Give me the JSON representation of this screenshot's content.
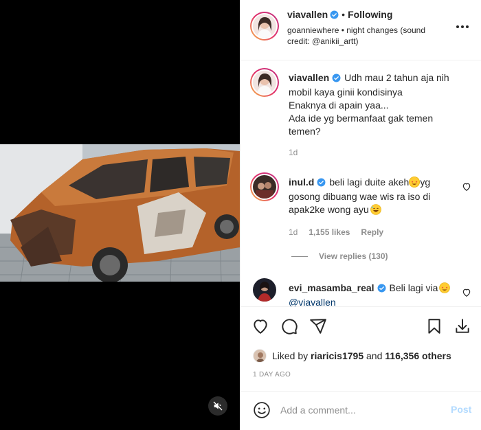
{
  "post": {
    "author": "viavallen",
    "following_label": "Following",
    "audio": "goanniewhere • night changes (sound credit: @anikii_artt)"
  },
  "caption": {
    "username": "viavallen",
    "lines": [
      "Udh mau 2 tahun aja nih",
      "mobil kaya ginii kondisinya",
      "Enaknya di apain yaa...",
      "Ada ide yg bermanfaat gak temen temen?"
    ],
    "age": "1d"
  },
  "comments": [
    {
      "username": "inul.d",
      "text_a": "beli lagi duite akeh",
      "text_b": "yg gosong dibuang wae wis ra iso di apak2ke wong ayu",
      "age": "1d",
      "likes": "1,155 likes",
      "reply_label": "Reply",
      "view_replies": "View replies (130)"
    },
    {
      "username": "evi_masamba_real",
      "text_a": "Beli lagi via",
      "mention": "@viavallen"
    }
  ],
  "likes": {
    "prefix": "Liked by",
    "user": "riaricis1795",
    "and": "and",
    "count": "116,356 others"
  },
  "timestamp": "1 day ago",
  "composer": {
    "placeholder": "Add a comment...",
    "post_label": "Post"
  },
  "colors": {
    "verified": "#3897f0",
    "link": "#00376b",
    "muted": "#8e8e8e",
    "post_disabled": "#b3dbff"
  }
}
